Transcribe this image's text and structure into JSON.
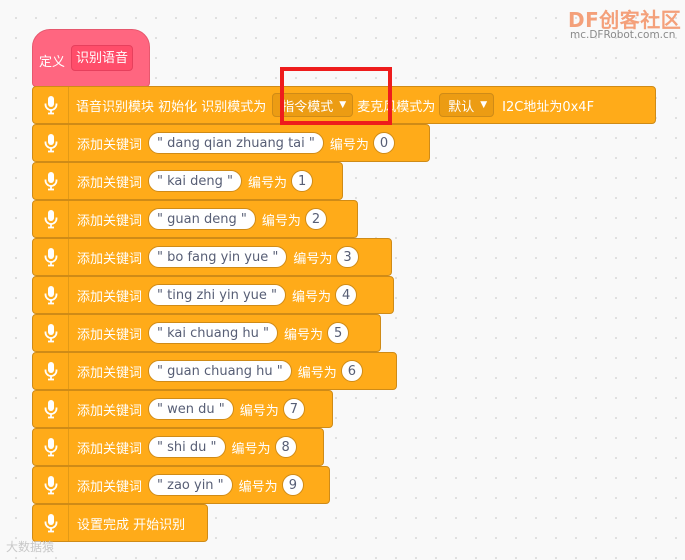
{
  "logo": {
    "brand": "DF创客社区",
    "url": "mc.DFRobot.com.cn"
  },
  "define_block": {
    "label": "定义",
    "name": "识别语音"
  },
  "init_block": {
    "text_1": "语音识别模块 初始化 识别模式为",
    "mode_value": "指令模式",
    "text_2": "麦克风模式为",
    "mic_value": "默认",
    "text_3": "I2C地址为0x4F"
  },
  "keyword_blocks": [
    {
      "label": "添加关键词",
      "keyword": "\" dang qian zhuang tai \"",
      "id_label": "编号为",
      "id": "0"
    },
    {
      "label": "添加关键词",
      "keyword": "\" kai deng \"",
      "id_label": "编号为",
      "id": "1"
    },
    {
      "label": "添加关键词",
      "keyword": "\" guan deng \"",
      "id_label": "编号为",
      "id": "2"
    },
    {
      "label": "添加关键词",
      "keyword": "\" bo fang yin yue \"",
      "id_label": "编号为",
      "id": "3"
    },
    {
      "label": "添加关键词",
      "keyword": "\" ting zhi yin yue  \"",
      "id_label": "编号为",
      "id": "4"
    },
    {
      "label": "添加关键词",
      "keyword": "\" kai chuang hu \"",
      "id_label": "编号为",
      "id": "5"
    },
    {
      "label": "添加关键词",
      "keyword": "\" guan chuang hu \"",
      "id_label": "编号为",
      "id": "6"
    },
    {
      "label": "添加关键词",
      "keyword": "\" wen du \"",
      "id_label": "编号为",
      "id": "7"
    },
    {
      "label": "添加关键词",
      "keyword": "\" shi du \"",
      "id_label": "编号为",
      "id": "8"
    },
    {
      "label": "添加关键词",
      "keyword": "\" zao yin \"",
      "id_label": "编号为",
      "id": "9"
    }
  ],
  "finish_block": {
    "text": "设置完成 开始识别"
  },
  "bottom_watermark": "大数据猿",
  "colors": {
    "block_orange": "#ffab19",
    "define_pink": "#ff6680",
    "highlight_red": "#ee1c1c"
  },
  "icons": {
    "block_icon": "microphone-icon"
  }
}
